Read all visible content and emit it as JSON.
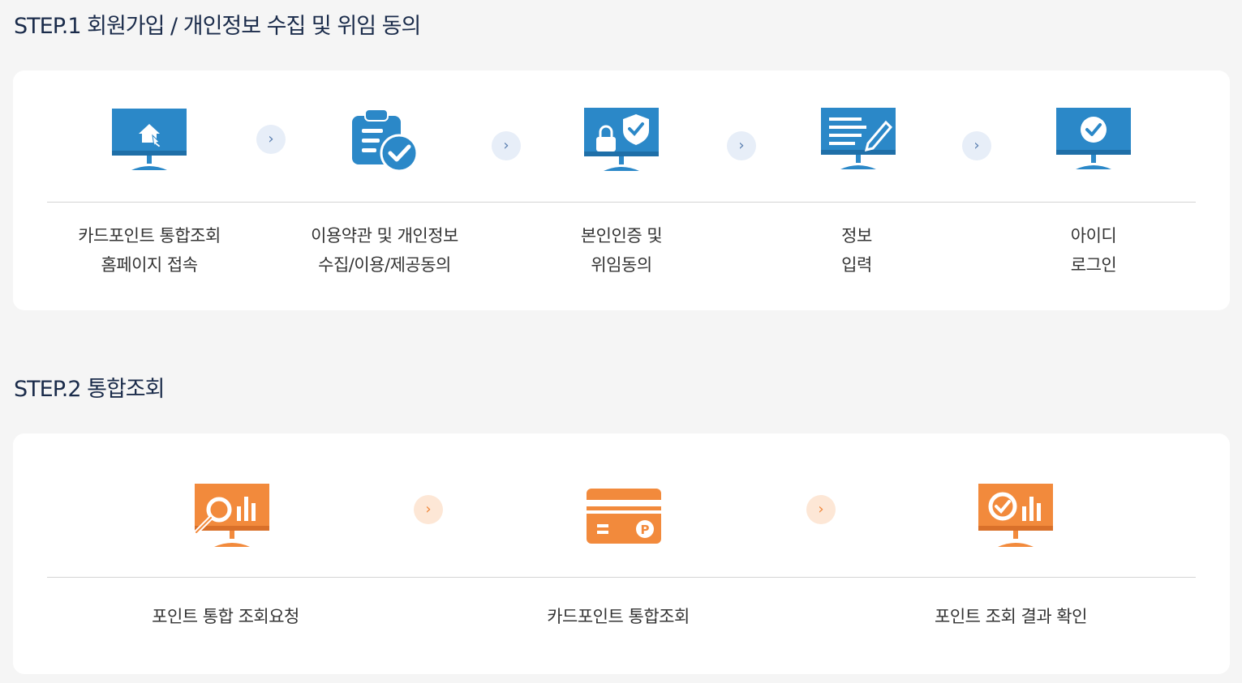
{
  "step1": {
    "title": "STEP.1 회원가입 / 개인정보 수집 및 위임 동의",
    "steps": [
      {
        "line1": "카드포인트 통합조회",
        "line2": "홈페이지 접속",
        "icon": "monitor-home-icon"
      },
      {
        "line1": "이용약관 및 개인정보",
        "line2": "수집/이용/제공동의",
        "icon": "clipboard-check-icon"
      },
      {
        "line1": "본인인증 및",
        "line2": "위임동의",
        "icon": "monitor-lock-shield-icon"
      },
      {
        "line1": "정보",
        "line2": "입력",
        "icon": "monitor-edit-icon"
      },
      {
        "line1": "아이디",
        "line2": "로그인",
        "icon": "monitor-check-icon"
      }
    ],
    "arrow": "›",
    "accent": "#2b88c8"
  },
  "step2": {
    "title": "STEP.2 통합조회",
    "steps": [
      {
        "line1": "포인트 통합 조회요청",
        "icon": "monitor-search-chart-icon"
      },
      {
        "line1": "카드포인트 통합조회",
        "icon": "point-card-icon"
      },
      {
        "line1": "포인트 조회 결과 확인",
        "icon": "monitor-check-chart-icon"
      }
    ],
    "arrow": "›",
    "accent": "#f28a3c"
  }
}
